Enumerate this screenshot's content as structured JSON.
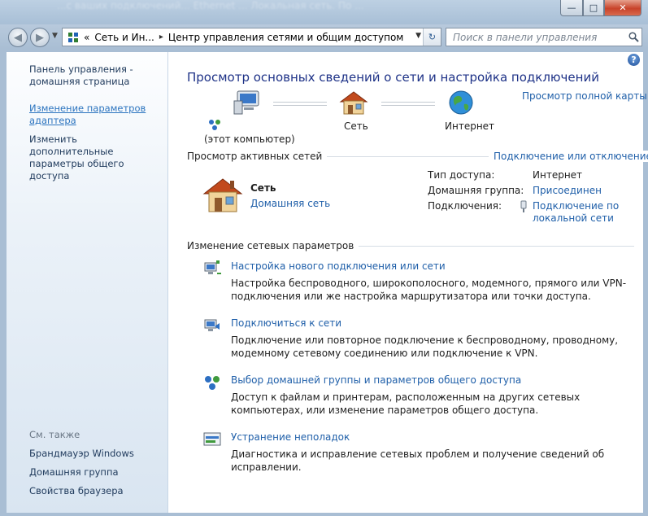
{
  "window": {
    "background_blur_text": "...с ваших подключений... Ethernet ... Локальная сеть. По ...",
    "caption_minimize": "—",
    "caption_maximize": "□",
    "caption_close": "✕"
  },
  "address_bar": {
    "crumb_prefix": "«",
    "crumb_1": "Сеть и Ин...",
    "crumb_sep": "▸",
    "crumb_2": "Центр управления сетями и общим доступом",
    "refresh_icon": "refresh-icon"
  },
  "search": {
    "placeholder": "Поиск в панели управления"
  },
  "sidebar": {
    "home_link": "Панель управления - домашняя страница",
    "adapter_link": "Изменение параметров адаптера",
    "sharing_link": "Изменить дополнительные параметры общего доступа",
    "see_also": "См. также",
    "see_also_items": [
      "Брандмауэр Windows",
      "Домашняя группа",
      "Свойства браузера"
    ]
  },
  "main": {
    "title": "Просмотр основных сведений о сети и настройка подключений",
    "full_map_link": "Просмотр полной карты",
    "map": {
      "computer_label": "(этот компьютер)",
      "network_label": "Сеть",
      "internet_label": "Интернет"
    },
    "active_networks": {
      "header": "Просмотр активных сетей",
      "connect_link": "Подключение или отключение",
      "network_name": "Сеть",
      "network_type_link": "Домашняя сеть",
      "access_type_label": "Тип доступа:",
      "access_type_value": "Интернет",
      "homegroup_label": "Домашняя группа:",
      "homegroup_value": "Присоединен",
      "connections_label": "Подключения:",
      "connections_value": "Подключение по локальной сети"
    },
    "change_settings": {
      "header": "Изменение сетевых параметров",
      "tasks": [
        {
          "title": "Настройка нового подключения или сети",
          "desc": "Настройка беспроводного, широкополосного, модемного, прямого или VPN-подключения или же настройка маршрутизатора или точки доступа."
        },
        {
          "title": "Подключиться к сети",
          "desc": "Подключение или повторное подключение к беспроводному, проводному, модемному сетевому соединению или подключение к VPN."
        },
        {
          "title": "Выбор домашней группы и параметров общего доступа",
          "desc": "Доступ к файлам и принтерам, расположенным на других сетевых компьютерах, или изменение параметров общего доступа."
        },
        {
          "title": "Устранение неполадок",
          "desc": "Диагностика и исправление сетевых проблем и получение сведений об исправлении."
        }
      ]
    }
  }
}
